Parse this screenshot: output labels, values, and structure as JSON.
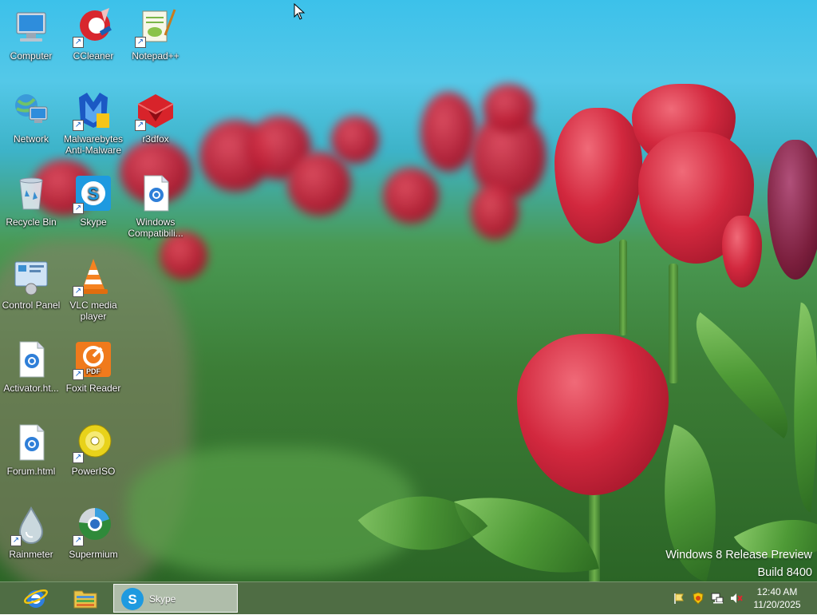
{
  "desktop": {
    "icons": [
      {
        "label": "Computer",
        "icon": "computer-icon",
        "shortcut": false
      },
      {
        "label": "CCleaner",
        "icon": "ccleaner-icon",
        "shortcut": true
      },
      {
        "label": "Notepad++",
        "icon": "notepadpp-icon",
        "shortcut": true
      },
      {
        "label": "Network",
        "icon": "network-icon",
        "shortcut": false
      },
      {
        "label": "Malwarebytes Anti-Malware",
        "icon": "malwarebytes-icon",
        "shortcut": true
      },
      {
        "label": "r3dfox",
        "icon": "r3dfox-icon",
        "shortcut": true
      },
      {
        "label": "Recycle Bin",
        "icon": "recycle-bin-icon",
        "shortcut": false
      },
      {
        "label": "Skype",
        "icon": "skype-icon",
        "shortcut": true
      },
      {
        "label": "Windows Compatibili...",
        "icon": "html-file-icon",
        "shortcut": false
      },
      {
        "label": "Control Panel",
        "icon": "control-panel-icon",
        "shortcut": false
      },
      {
        "label": "VLC media player",
        "icon": "vlc-icon",
        "shortcut": true
      },
      {
        "label": "Activator.ht...",
        "icon": "html-file-icon",
        "shortcut": false
      },
      {
        "label": "Foxit Reader",
        "icon": "foxit-reader-icon",
        "shortcut": true
      },
      {
        "label": "Forum.html",
        "icon": "html-file-icon",
        "shortcut": false
      },
      {
        "label": "PowerISO",
        "icon": "poweriso-icon",
        "shortcut": true
      },
      {
        "label": "Rainmeter",
        "icon": "rainmeter-icon",
        "shortcut": true
      },
      {
        "label": "Supermium",
        "icon": "supermium-icon",
        "shortcut": true
      }
    ],
    "watermark": {
      "line1": "Windows 8 Release Preview",
      "line2": "Build 8400"
    }
  },
  "taskbar": {
    "pinned": [
      {
        "name": "Internet Explorer",
        "icon": "internet-explorer-icon"
      },
      {
        "name": "File Explorer",
        "icon": "file-explorer-icon"
      }
    ],
    "running": [
      {
        "label": "Skype",
        "icon": "skype-icon",
        "active": true
      }
    ],
    "tray_icons": [
      "action-center-flag-icon",
      "security-shield-icon",
      "network-icon",
      "volume-muted-icon"
    ],
    "clock": {
      "time": "12:40 AM",
      "date": "11/20/2025"
    }
  },
  "colors": {
    "taskbar": "#4f6d44",
    "sky": "#3cc1ea",
    "tulip_red": "#d2283e",
    "label_text": "#ffffff"
  }
}
